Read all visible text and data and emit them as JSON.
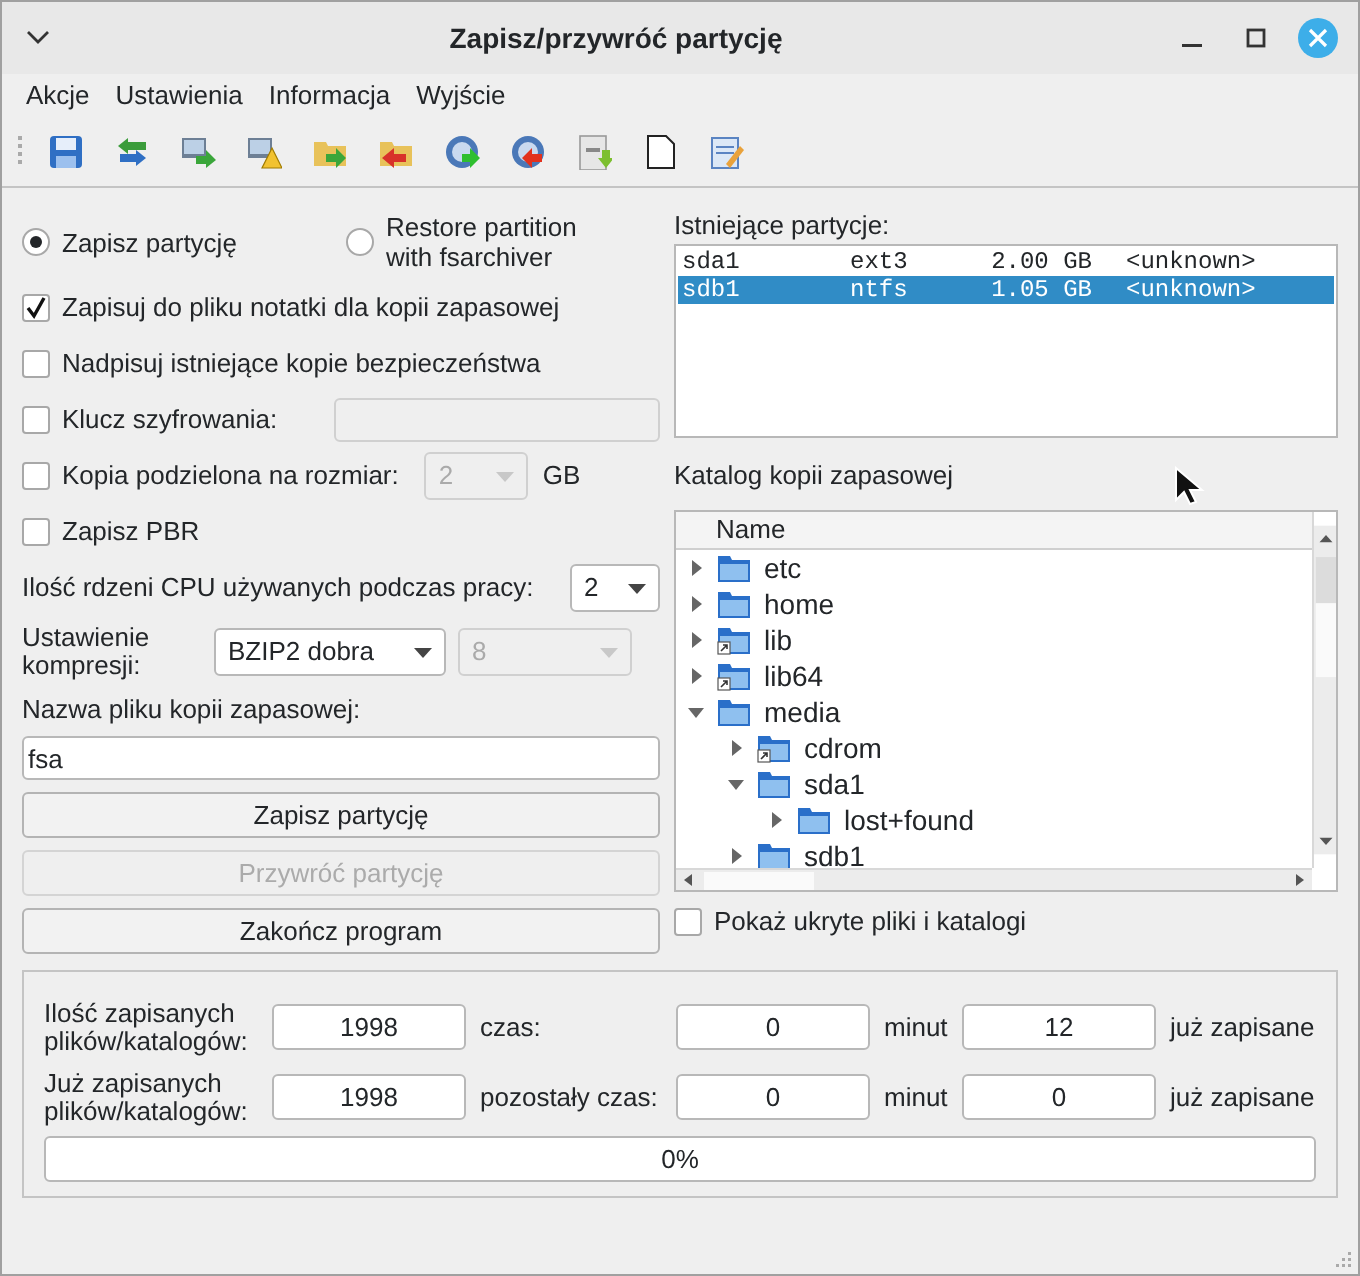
{
  "window": {
    "title": "Zapisz/przywróć partycję"
  },
  "menu": [
    "Akcje",
    "Ustawienia",
    "Informacja",
    "Wyjście"
  ],
  "mode_options": [
    {
      "label": "Zapisz partycję",
      "selected": true
    },
    {
      "label": "Restore partition with fsarchiver",
      "selected": false
    }
  ],
  "options": [
    {
      "kind": "checkbox",
      "label": "Zapisuj do pliku notatki dla kopii zapasowej",
      "checked": true
    },
    {
      "kind": "checkbox",
      "label": "Nadpisuj istniejące kopie bezpieczeństwa",
      "checked": false
    },
    {
      "kind": "key",
      "label": "Klucz szyfrowania:",
      "checked": false
    },
    {
      "kind": "split",
      "label": "Kopia podzielona na rozmiar:",
      "checked": false,
      "value": "2",
      "unit": "GB"
    },
    {
      "kind": "checkbox",
      "label": "Zapisz PBR",
      "checked": false
    }
  ],
  "cpu": {
    "label": "Ilość rdzeni CPU używanych podczas pracy:",
    "value": "2"
  },
  "compression": {
    "label": "Ustawienie kompresji:",
    "value": "BZIP2 dobra",
    "level_value": "8"
  },
  "filename": {
    "label": "Nazwa pliku kopii zapasowej:",
    "value": "fsa"
  },
  "buttons": [
    {
      "label": "Zapisz partycję",
      "disabled": false
    },
    {
      "label": "Przywróć partycję",
      "disabled": true
    },
    {
      "label": "Zakończ program",
      "disabled": false
    }
  ],
  "partitions": {
    "label": "Istniejące partycje:",
    "rows": [
      {
        "device": "sda1",
        "fs": "ext3",
        "size": "2.00 GB",
        "name": "<unknown>",
        "selected": false
      },
      {
        "device": "sdb1",
        "fs": "ntfs",
        "size": "1.05 GB",
        "name": "<unknown>",
        "selected": true
      }
    ]
  },
  "backup_dir": {
    "label": "Katalog kopii zapasowej",
    "column": "Name",
    "tree": [
      {
        "name": "etc",
        "symlink": false,
        "expanded": false
      },
      {
        "name": "home",
        "symlink": false,
        "expanded": false
      },
      {
        "name": "lib",
        "symlink": true,
        "expanded": false
      },
      {
        "name": "lib64",
        "symlink": true,
        "expanded": false
      },
      {
        "name": "media",
        "symlink": false,
        "expanded": true,
        "children": [
          {
            "name": "cdrom",
            "symlink": true,
            "expanded": false
          },
          {
            "name": "sda1",
            "symlink": false,
            "expanded": true,
            "children": [
              {
                "name": "lost+found",
                "symlink": false,
                "expanded": false
              }
            ]
          },
          {
            "name": "sdb1",
            "symlink": false,
            "expanded": false
          }
        ]
      }
    ]
  },
  "show_hidden": {
    "label": "Pokaż ukryte pliki i katalogi",
    "checked": false
  },
  "progress": {
    "rows": [
      {
        "label": "Ilość zapisanych plików/katalogów:",
        "count": "1998",
        "time_label": "czas:",
        "minutes": "0",
        "minutes_label": "minut",
        "seconds": "12",
        "status": "już zapisane"
      },
      {
        "label": "Już zapisanych plików/katalogów:",
        "count": "1998",
        "time_label": "pozostały czas:",
        "minutes": "0",
        "minutes_label": "minut",
        "seconds": "0",
        "status": "już zapisane"
      }
    ],
    "level": 0,
    "text": "0%"
  }
}
